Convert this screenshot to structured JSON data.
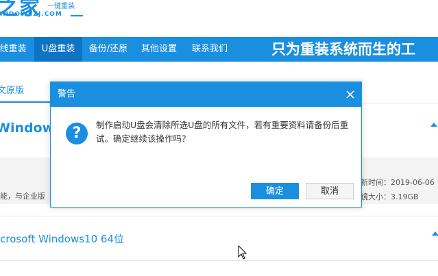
{
  "header": {
    "logo_main": "之家",
    "logo_sub": "一键重装",
    "logo_url": "INDOWSZJ.COM"
  },
  "nav": {
    "items": [
      {
        "label": "线重装"
      },
      {
        "label": "U盘重装",
        "active": true
      },
      {
        "label": "备份/还原"
      },
      {
        "label": "其他设置"
      },
      {
        "label": "联系我们"
      }
    ],
    "slogan": "只为重装系统而生的工"
  },
  "content": {
    "sub_tab": "文原版",
    "items": [
      {
        "title": "Windows7",
        "description": "能，与企业版",
        "update_time": "新时间：2019-06-06",
        "size": "镜大小：3.19GB"
      },
      {
        "title": "icrosoft Windows10 64位"
      }
    ]
  },
  "dialog": {
    "title": "警告",
    "icon_glyph": "?",
    "message": "制作启动U盘会清除所选U盘的所有文件，若有重要资料请备份后重试。确定继续该操作吗？",
    "ok_label": "确定",
    "cancel_label": "取消"
  },
  "colors": {
    "accent": "#1a8fe0",
    "accent_dark": "#0d74c4",
    "band": "#f3f3f3"
  }
}
